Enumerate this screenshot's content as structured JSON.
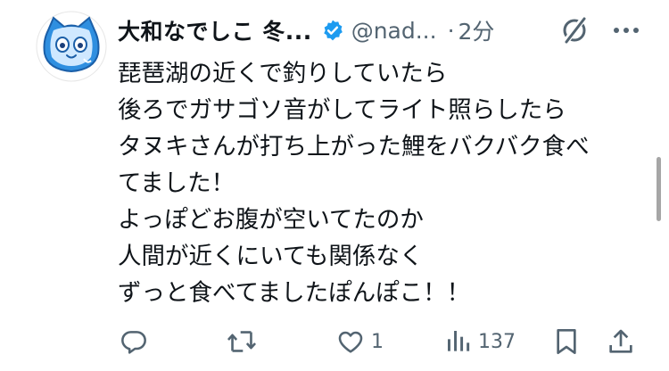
{
  "post": {
    "author_name": "大和なでしこ 冬...",
    "handle": "@nad...",
    "separator": "·",
    "time": "2分",
    "body_lines": [
      "琵琶湖の近くで釣りしていたら",
      "後ろでガサゴソ音がしてライト照らしたら",
      "タヌキさんが打ち上がった鯉をバクバク食べ",
      "てました！",
      "よっぽどお腹が空いてたのか",
      "人間が近くにいても関係なく",
      "ずっと食べてましたぽんぽこ！！"
    ]
  },
  "actions": {
    "reply_count": "",
    "repost_count": "",
    "like_count": "1",
    "views_count": "137"
  },
  "icons": {
    "avatar": "blue-cat-mascot-icon",
    "verified": "verified-badge-icon",
    "grok": "grok-icon",
    "more": "more-dots-icon",
    "reply": "reply-icon",
    "repost": "repost-icon",
    "like": "heart-icon",
    "views": "views-chart-icon",
    "bookmark": "bookmark-icon",
    "share": "share-icon"
  },
  "colors": {
    "text": "#0f1419",
    "muted": "#536471",
    "verified": "#1d9bf0",
    "avatar_blue": "#2f8fe0"
  }
}
